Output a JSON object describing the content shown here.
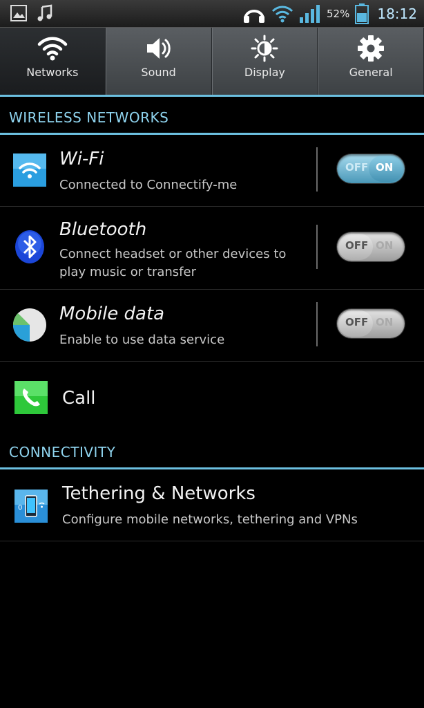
{
  "statusbar": {
    "battery_percent": "52%",
    "time": "18:12",
    "signal_bars": 4
  },
  "tabs": [
    {
      "label": "Networks",
      "icon": "wifi-icon",
      "active": true
    },
    {
      "label": "Sound",
      "icon": "speaker-icon",
      "active": false
    },
    {
      "label": "Display",
      "icon": "brightness-icon",
      "active": false
    },
    {
      "label": "General",
      "icon": "gear-icon",
      "active": false
    }
  ],
  "sections": {
    "wireless": "WIRELESS NETWORKS",
    "connectivity": "CONNECTIVITY"
  },
  "items": {
    "wifi": {
      "title": "Wi-Fi",
      "subtitle": "Connected to Connectify-me",
      "toggle_off": "OFF",
      "toggle_on": "ON",
      "state": "on"
    },
    "bluetooth": {
      "title": "Bluetooth",
      "subtitle": "Connect headset or other devices to play music or transfer",
      "toggle_off": "OFF",
      "toggle_on": "ON",
      "state": "off"
    },
    "mobile_data": {
      "title": "Mobile data",
      "subtitle": "Enable to use data service",
      "toggle_off": "OFF",
      "toggle_on": "ON",
      "state": "off"
    },
    "call": {
      "title": "Call"
    },
    "tethering": {
      "title": "Tethering & Networks",
      "subtitle": "Configure mobile networks, tethering and VPNs"
    }
  },
  "colors": {
    "accent": "#6cc0e0",
    "section_text": "#8fd4ef"
  }
}
